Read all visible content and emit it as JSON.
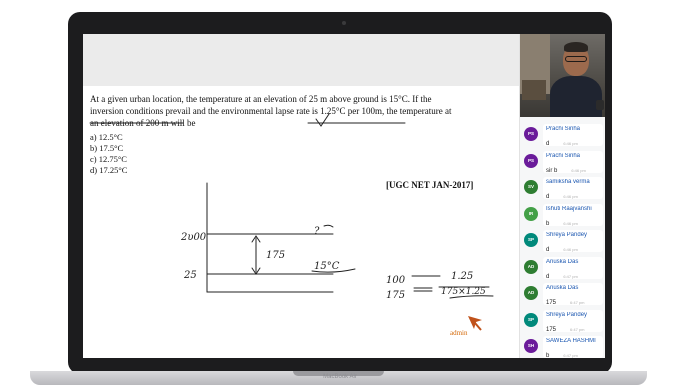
{
  "device": {
    "label": "MacBook Air"
  },
  "slide": {
    "question_line1": "At a given urban location, the temperature at an elevation of 25 m above ground is 15°C. If the",
    "question_line2": "inversion conditions prevail and the environmental lapse rate is 1.25°C per 100m, the temperature at",
    "question_line3": "an elevation of 200 m will be",
    "options": [
      "a)  12.5°C",
      "b)  17.5°C",
      "c)  12.75°C",
      "d)  17.25°C"
    ],
    "reference": "[UGC NET JAN-2017]",
    "author_label": "admin"
  },
  "annotations": {
    "elev_top": "2υ00",
    "elev_bottom": "25",
    "diff": "175",
    "unknown": "?",
    "base_temp": "15°C",
    "calc_r1_left": "100",
    "calc_r1_right": "1.25",
    "calc_r2_left": "175",
    "calc_r2_right": "175×1.25"
  },
  "chat": {
    "messages": [
      {
        "initials": "PS",
        "name": "Prachi Sinha",
        "text": "d",
        "time": "6:46 pm",
        "color": "#6a1b9a"
      },
      {
        "initials": "PS",
        "name": "Prachi Sinha",
        "text": "sir b",
        "time": "6:46 pm",
        "color": "#6a1b9a"
      },
      {
        "initials": "SV",
        "name": "samiksha verma",
        "text": "d",
        "time": "6:46 pm",
        "color": "#2e7d32"
      },
      {
        "initials": "IR",
        "name": "Ishuti Raajvanshi",
        "text": "b",
        "time": "6:46 pm",
        "color": "#43a047"
      },
      {
        "initials": "SP",
        "name": "Shreya Pandey",
        "text": "d",
        "time": "6:46 pm",
        "color": "#00897b"
      },
      {
        "initials": "AD",
        "name": "Anuska Das",
        "text": "d",
        "time": "6:47 pm",
        "color": "#2e7d32"
      },
      {
        "initials": "AD",
        "name": "Anuska Das",
        "text": "175",
        "time": "6:47 pm",
        "color": "#2e7d32"
      },
      {
        "initials": "SP",
        "name": "Shreya Pandey",
        "text": "175",
        "time": "6:47 pm",
        "color": "#00897b"
      },
      {
        "initials": "SH",
        "name": "SAWEZA HASHMI",
        "text": "b",
        "time": "6:47 pm",
        "color": "#6a1b9a"
      }
    ]
  }
}
